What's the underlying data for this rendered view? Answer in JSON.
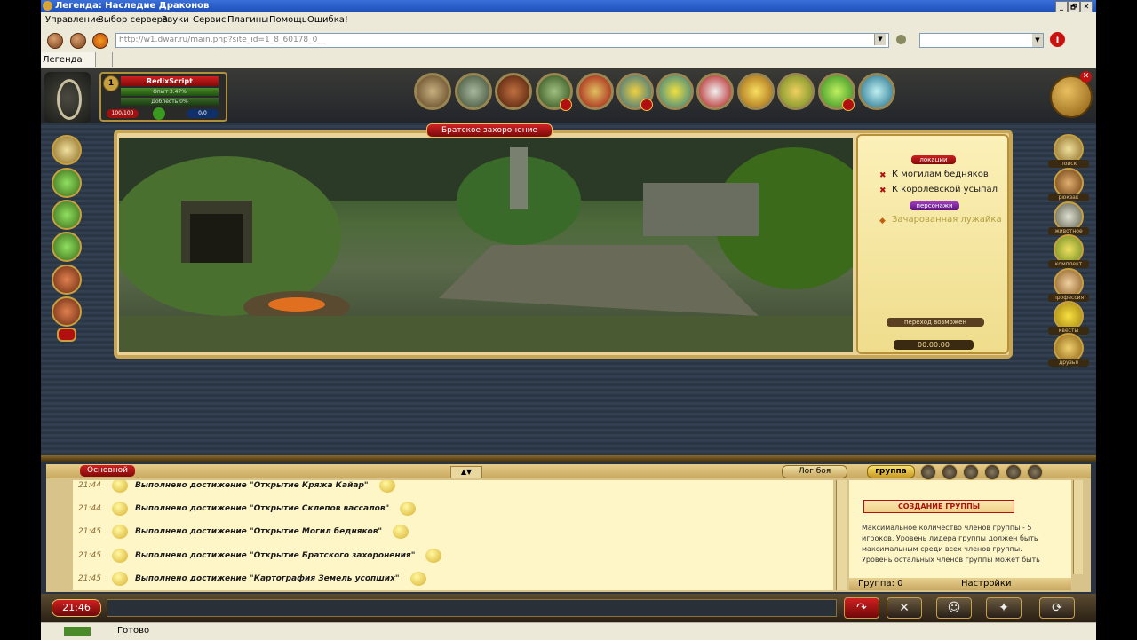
{
  "window": {
    "title": "Легенда: Наследие Драконов",
    "controls": [
      "_",
      "🗗",
      "✕"
    ]
  },
  "menu": [
    "Управление",
    "Выбор сервера",
    "Звуки",
    "Сервис",
    "Плагины",
    "Помощь",
    "Ошибка!"
  ],
  "address": {
    "url": "http://w1.dwar.ru/main.php?site_id=1_8_60178_0__"
  },
  "tabs": [
    "Легенда"
  ],
  "character": {
    "name": "RedixScript",
    "rank": "1",
    "experience": "Опыт 3.47%",
    "valor": "Доблесть 0%",
    "hp": "100/100",
    "mp": "0/0"
  },
  "location": {
    "title": "Братское захоронение",
    "section_locations": "локации",
    "links": [
      "К могилам бедняков",
      "К королевской усыпал"
    ],
    "section_characters": "персонажи",
    "characters": [
      "Зачарованная лужайка"
    ],
    "transition": "переход возможен",
    "timer": "00:00:00"
  },
  "right_menu": [
    "поиск",
    "рюкзак",
    "животное",
    "комплект",
    "профессия",
    "квесты",
    "друзья"
  ],
  "chat": {
    "tab": "Основной",
    "log_button": "Лог боя",
    "lines": [
      {
        "time": "21:44",
        "text": "Выполнено достижение \"Открытие Кряжа Кайар\""
      },
      {
        "time": "21:44",
        "text": "Выполнено достижение \"Открытие Склепов вассалов\""
      },
      {
        "time": "21:45",
        "text": "Выполнено достижение \"Открытие Могил бедняков\""
      },
      {
        "time": "21:45",
        "text": "Выполнено достижение \"Открытие Братского захоронения\""
      },
      {
        "time": "21:45",
        "text": "Выполнено достижение \"Картография Земель усопших\""
      }
    ]
  },
  "group": {
    "button": "группа",
    "create": "СОЗДАНИЕ ГРУППЫ",
    "description": "Максимальное количество членов группы - 5 игроков. Уровень лидера группы должен быть максимальным среди всех членов группы. Уровень остальных членов группы может быть",
    "count": "Группа: 0",
    "settings": "Настройки"
  },
  "bottom": {
    "clock": "21:46"
  },
  "status": {
    "text": "Готово"
  },
  "colors": {
    "accent_red": "#d02020",
    "gold": "#c8a656",
    "parchment": "#fff6c8"
  }
}
